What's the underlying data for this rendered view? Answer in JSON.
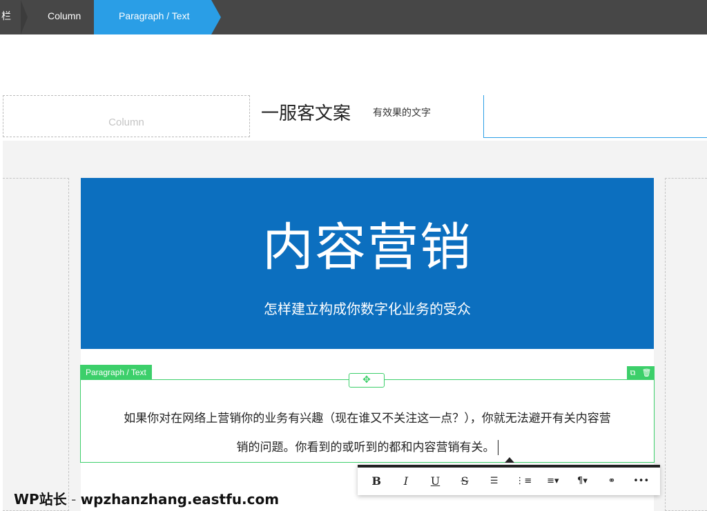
{
  "breadcrumb": {
    "items": [
      "栏",
      "Column",
      "Paragraph / Text"
    ]
  },
  "header": {
    "column_placeholder": "Column",
    "brand": "一服客文案",
    "tagline": "有效果的文字"
  },
  "hero": {
    "title": "内容营销",
    "subtitle": "怎样建立构成你数字化业务的受众"
  },
  "paragraph": {
    "tag": "Paragraph / Text",
    "line1": "如果你对在网络上营销你的业务有兴趣（现在谁又不关注这一点？），你就无法避开有关内容营",
    "line2": "销的问题。你看到的或听到的都和内容营销有关。"
  },
  "toolbar": {
    "bold": "B",
    "italic": "I",
    "underline": "U",
    "strike": "S",
    "more": "•••"
  },
  "watermark": {
    "brand": "WP站长",
    "sep": " - ",
    "url": "wpzhanzhang.eastfu.com"
  },
  "colors": {
    "topbar": "#474747",
    "accent_blue": "#2a9ee6",
    "hero_blue": "#0c6fbf",
    "green": "#3ccf6a"
  },
  "icons": [
    "move-icon",
    "duplicate-icon",
    "trash-icon",
    "bullet-list-icon",
    "numbered-list-icon",
    "align-icon",
    "paragraph-icon",
    "link-icon"
  ]
}
